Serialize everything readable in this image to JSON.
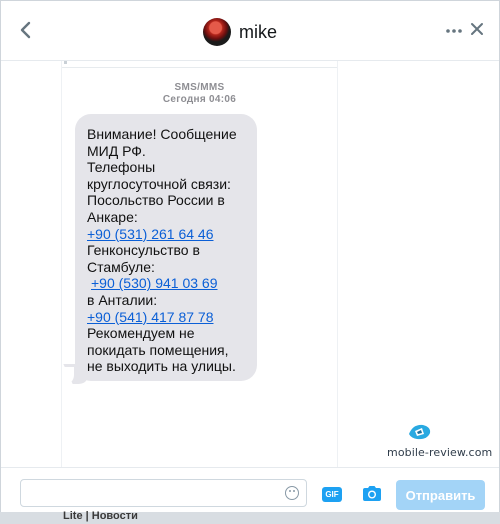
{
  "header": {
    "contact_name": "mike",
    "back_icon": "chevron-left-icon",
    "more_icon": "ellipsis-icon",
    "close_icon": "close-icon"
  },
  "conversation": {
    "service_label": "SMS/MMS",
    "timestamp": "Сегодня 04:06",
    "message": {
      "line1": "Внимание! Сообщение МИД РФ.",
      "line2": "Телефоны круглосуточной связи:",
      "line3": "Посольство России в Анкаре:",
      "phone1": "+90 (531) 261 64 46",
      "line4": "Генконсульство в Стамбуле:",
      "phone2": "+90 (530) 941 03 69",
      "line5": "в Анталии:",
      "phone3": "+90 (541) 417 87 78",
      "line6": "Рекомендуем не покидать помещения, не выходить на улицы."
    }
  },
  "watermark": {
    "text": "mobile-review.com"
  },
  "composer": {
    "input_value": "",
    "gif_label": "GIF",
    "send_label": "Отправить"
  },
  "background": {
    "text": "Lite | Новости"
  },
  "colors": {
    "accent": "#1da1f2",
    "send_disabled": "#a3d4f7",
    "bubble": "#e5e5ea",
    "link": "#0b5fd6"
  }
}
